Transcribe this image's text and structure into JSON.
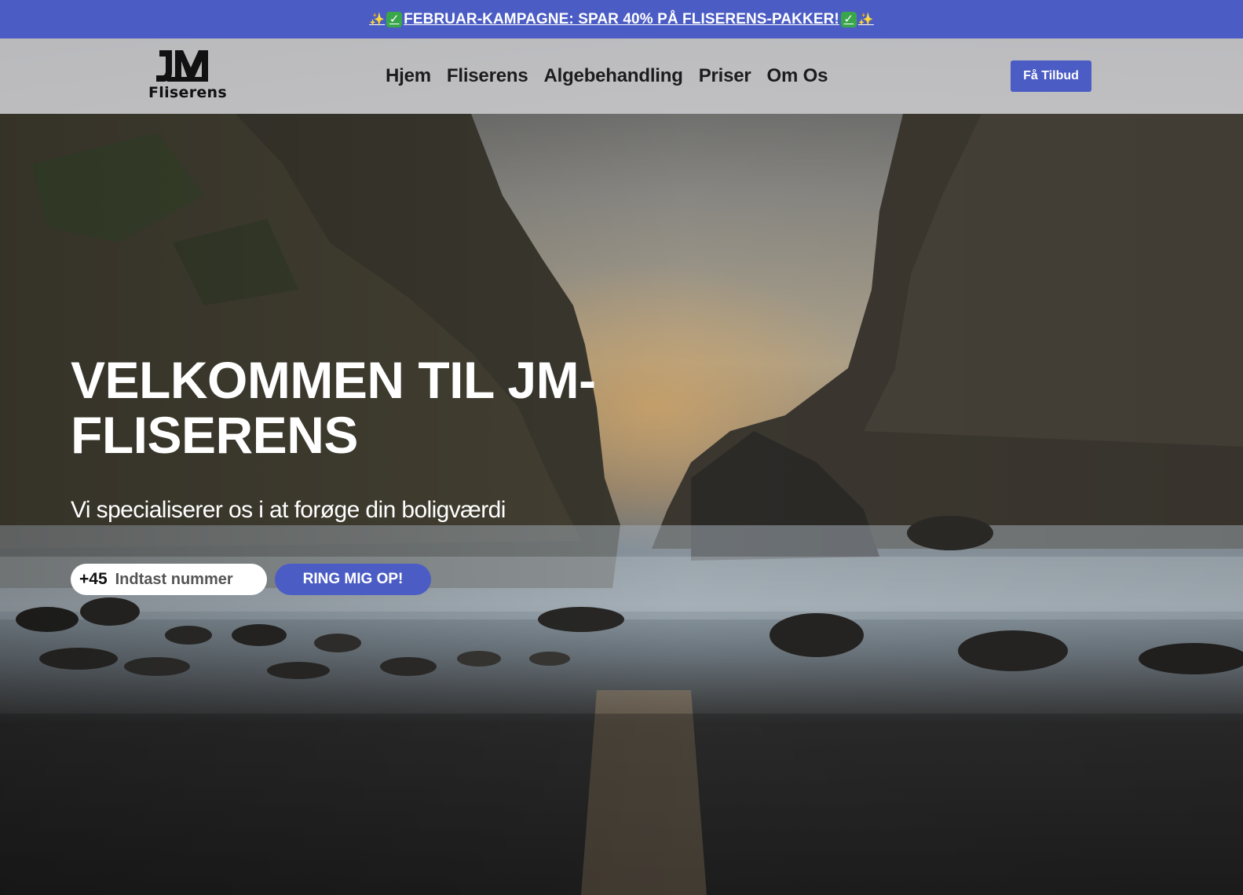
{
  "promo": {
    "sparkle_left": "✨",
    "check_left": "✓",
    "text": "FEBRUAR-KAMPAGNE: SPAR 40% PÅ FLISERENS-PAKKER!",
    "check_right": "✓",
    "sparkle_right": "✨"
  },
  "header": {
    "logo_text": "Fliserens",
    "nav": [
      "Hjem",
      "Fliserens",
      "Algebehandling",
      "Priser",
      "Om Os"
    ],
    "cta_label": "Få Tilbud"
  },
  "hero": {
    "title": "VELKOMMEN TIL JM-FLISERENS",
    "subtitle": "Vi specialiserer os i at forøge din boligværdi",
    "phone_prefix": "+45",
    "phone_placeholder": "Indtast nummer",
    "phone_value": "",
    "call_button": "RING MIG OP!"
  },
  "colors": {
    "accent": "#4b5cc4",
    "nav_text": "#1c1c1e",
    "hero_text": "#ffffff"
  }
}
